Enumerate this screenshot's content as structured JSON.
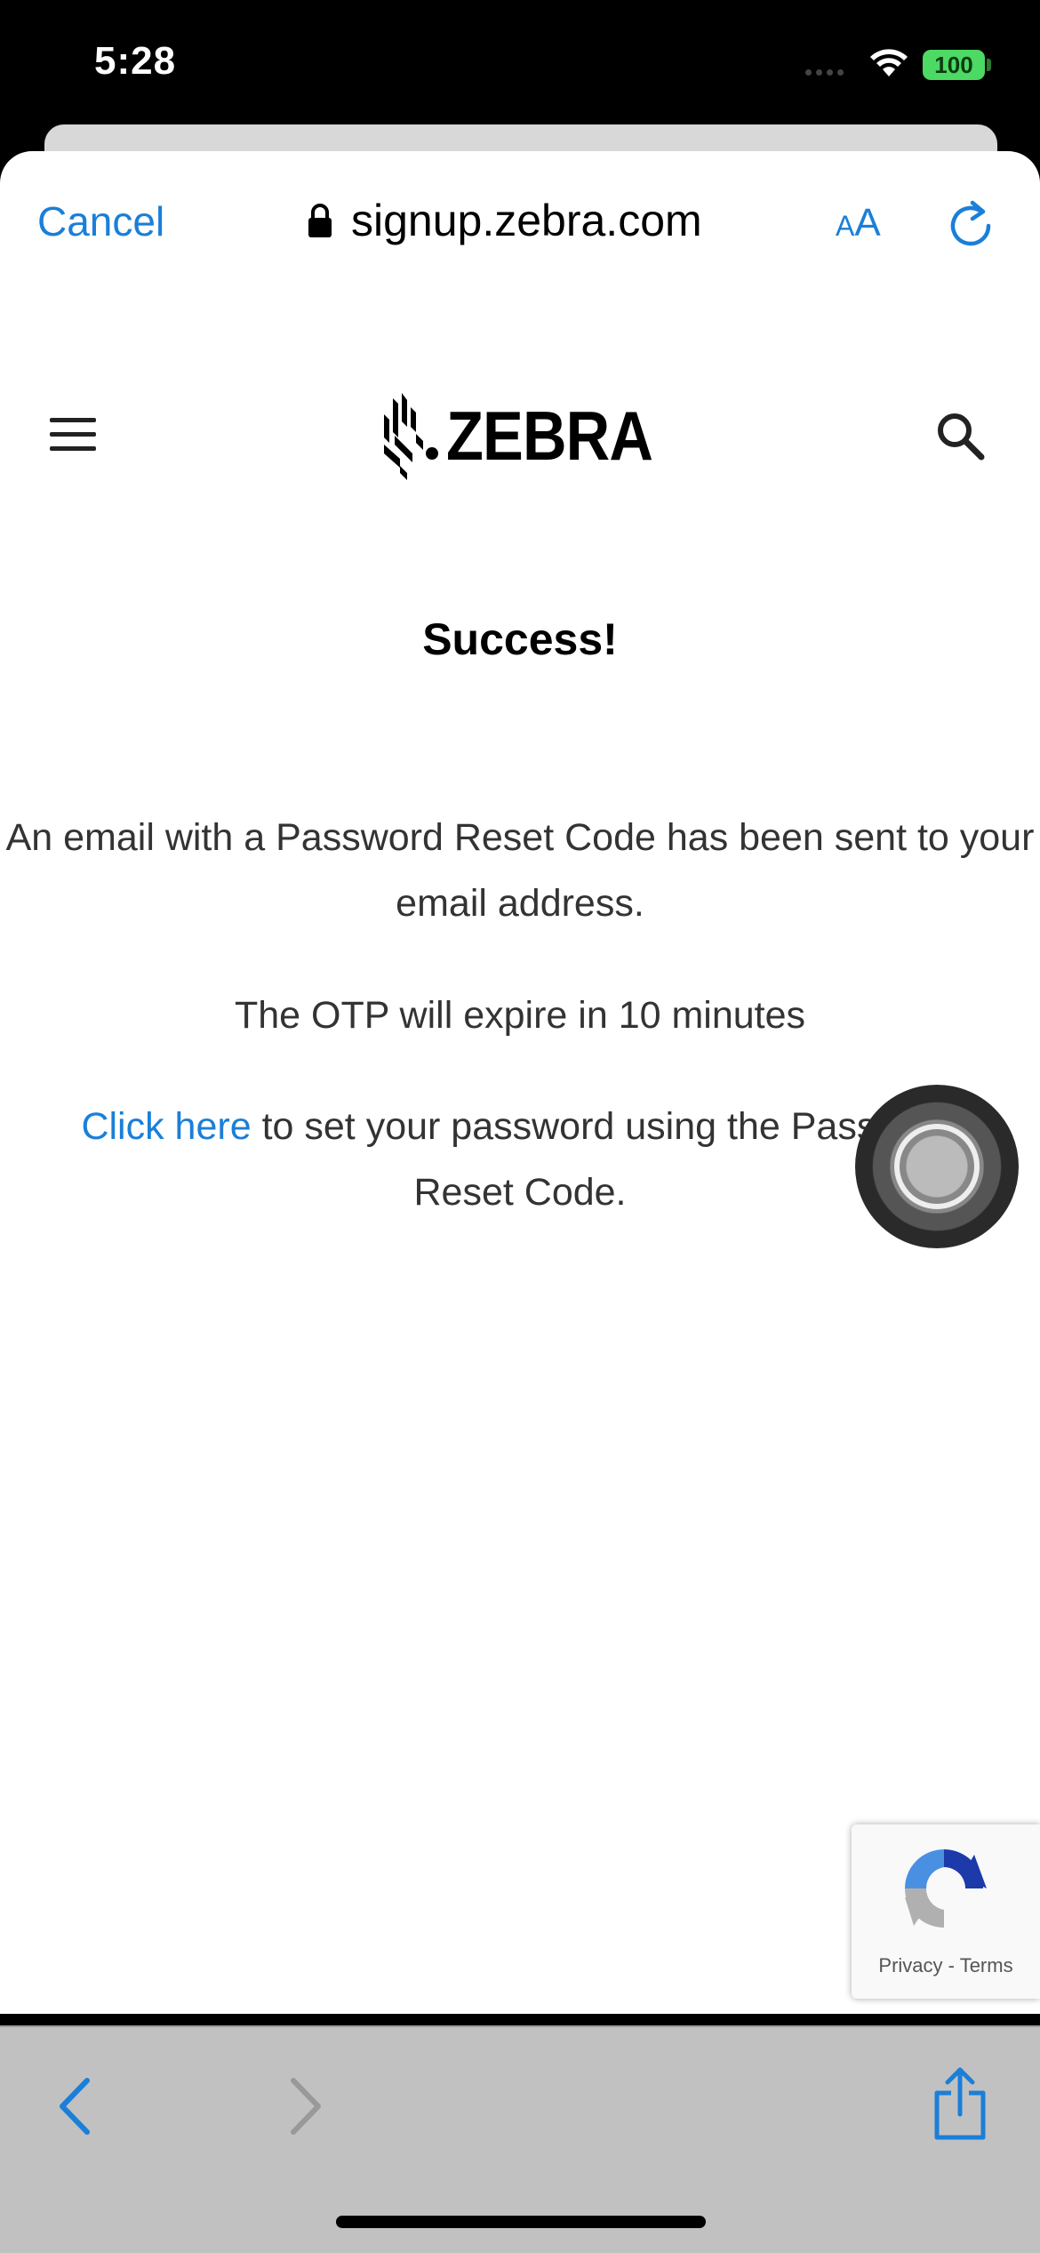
{
  "status_bar": {
    "time": "5:28",
    "battery": "100"
  },
  "nav": {
    "cancel_label": "Cancel",
    "url": "signup.zebra.com",
    "text_size_label_small": "A",
    "text_size_label_large": "A"
  },
  "site": {
    "brand": "ZEBRA"
  },
  "content": {
    "title": "Success!",
    "message": "An email with a Password Reset Code has been sent to your email address.",
    "otp_notice": "The OTP will expire in 10 minutes",
    "link_text": "Click here",
    "link_suffix": " to set your password using the Password Reset Code."
  },
  "recaptcha": {
    "privacy": "Privacy",
    "separator": " - ",
    "terms": "Terms"
  },
  "colors": {
    "accent": "#1a7fd8",
    "battery": "#4cd964",
    "toolbar": "#c1c1c1"
  }
}
